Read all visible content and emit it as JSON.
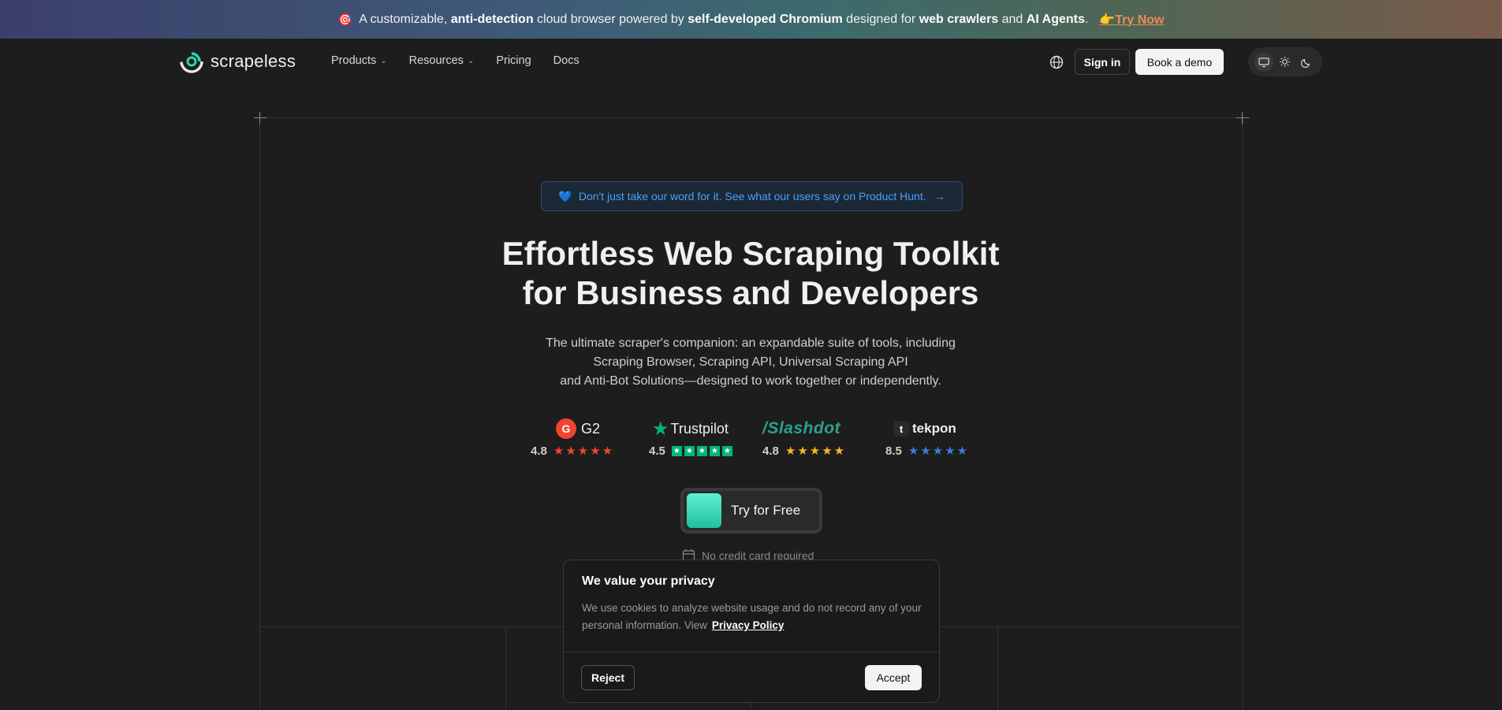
{
  "banner": {
    "emoji": "🎯",
    "text_a": "A customizable, ",
    "bold_a": "anti-detection",
    "text_b": " cloud browser powered by ",
    "bold_b": "self-developed Chromium",
    "text_c": " designed for ",
    "bold_c": "web crawlers",
    "text_d": " and ",
    "bold_d": "AI Agents",
    "text_e": ".",
    "cta_emoji": "👉",
    "cta_label": "Try Now"
  },
  "nav": {
    "logo_text": "scrapeless",
    "links": [
      "Products",
      "Resources",
      "Pricing",
      "Docs"
    ],
    "signin_label": "Sign in",
    "demo_label": "Book a demo"
  },
  "hero": {
    "pill_text": "Don't just take our word for it. See what our users say on Product Hunt.",
    "pill_arrow": "→",
    "title_line1": "Effortless Web Scraping Toolkit",
    "title_line2": "for Business and Developers",
    "subtitle_line1": "The ultimate scraper's companion: an expandable suite of tools, including",
    "subtitle_line2": "Scraping Browser, Scraping API, Universal Scraping API",
    "subtitle_line3": "and Anti-Bot Solutions—designed to work together or independently.",
    "cta_label": "Try for Free",
    "nocard_text": "No credit card required"
  },
  "ratings": [
    {
      "brand": "G2",
      "score": "4.8",
      "stars": 5,
      "color": "#f0452f"
    },
    {
      "brand": "Trustpilot",
      "score": "4.5",
      "stars": 5,
      "color": "#00b67a"
    },
    {
      "brand": "Slashdot",
      "score": "4.8",
      "stars": 5,
      "color": "#f6b820"
    },
    {
      "brand": "tekpon",
      "score": "8.5",
      "stars": 5,
      "color": "#3b7bd6"
    }
  ],
  "cookie": {
    "title": "We value your privacy",
    "body": "We use cookies to analyze website usage and do not record any of your personal information. View",
    "link": "Privacy Policy",
    "reject_label": "Reject",
    "accept_label": "Accept"
  }
}
